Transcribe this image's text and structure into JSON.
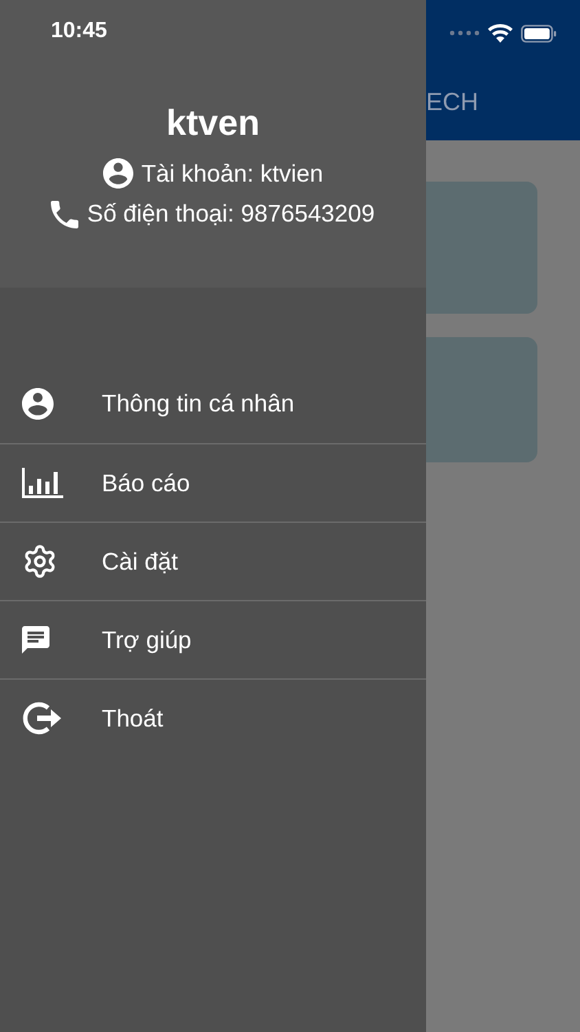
{
  "status_bar": {
    "time": "10:45"
  },
  "app_bar": {
    "title": "ECH"
  },
  "profile": {
    "name": "ktven",
    "account": "Tài khoản: ktvien",
    "phone": "Số điện thoại: 9876543209"
  },
  "menu": [
    {
      "label": "Thông tin cá nhân",
      "kind": "profile"
    },
    {
      "label": "Báo cáo",
      "kind": "report"
    },
    {
      "label": "Cài đặt",
      "kind": "settings"
    },
    {
      "label": "Trợ giúp",
      "kind": "help"
    },
    {
      "label": "Thoát",
      "kind": "logout"
    }
  ]
}
